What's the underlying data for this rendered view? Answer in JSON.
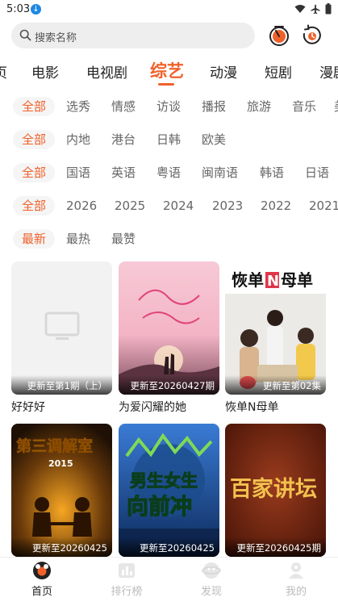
{
  "status_bar": {
    "time": "5:03"
  },
  "search": {
    "placeholder": "搜索名称"
  },
  "category_tabs": [
    "页",
    "电影",
    "电视剧",
    "综艺",
    "动漫",
    "短剧",
    "漫剧"
  ],
  "category_active": "综艺",
  "filters": {
    "type": {
      "items": [
        "全部",
        "选秀",
        "情感",
        "访谈",
        "播报",
        "旅游",
        "音乐",
        "美"
      ],
      "active": "全部"
    },
    "region": {
      "items": [
        "全部",
        "内地",
        "港台",
        "日韩",
        "欧美"
      ],
      "active": "全部"
    },
    "language": {
      "items": [
        "全部",
        "国语",
        "英语",
        "粤语",
        "闽南语",
        "韩语",
        "日语"
      ],
      "active": "全部"
    },
    "year": {
      "items": [
        "全部",
        "2026",
        "2025",
        "2024",
        "2023",
        "2022",
        "2021"
      ],
      "active": "全部"
    },
    "sort": {
      "items": [
        "最新",
        "最热",
        "最赞"
      ],
      "active": "最新"
    }
  },
  "shows": [
    {
      "title": "好好好",
      "update": "更新至第1期（上）",
      "poster": "placeholder"
    },
    {
      "title": "为爱闪耀的她",
      "update": "更新至20260427期",
      "poster": "为爱闪耀的她"
    },
    {
      "title": "恢单N母单",
      "update": "更新至第02集",
      "poster": "恢单N母单"
    },
    {
      "title": "",
      "update": "更新至20260425",
      "poster": "第三调解室 2015"
    },
    {
      "title": "",
      "update": "更新至20260425",
      "poster": "男生女生向前冲"
    },
    {
      "title": "",
      "update": "更新至20260425期",
      "poster": "百家讲坛"
    }
  ],
  "bottom_nav": [
    {
      "label": "首页",
      "icon": "home-icon",
      "active": true
    },
    {
      "label": "排行榜",
      "icon": "ranking-icon",
      "active": false
    },
    {
      "label": "发现",
      "icon": "discover-icon",
      "active": false
    },
    {
      "label": "我的",
      "icon": "profile-icon",
      "active": false
    }
  ],
  "colors": {
    "accent": "#f0612a",
    "chip_bg": "#f5f5f5",
    "search_bg": "#eeeeee"
  }
}
